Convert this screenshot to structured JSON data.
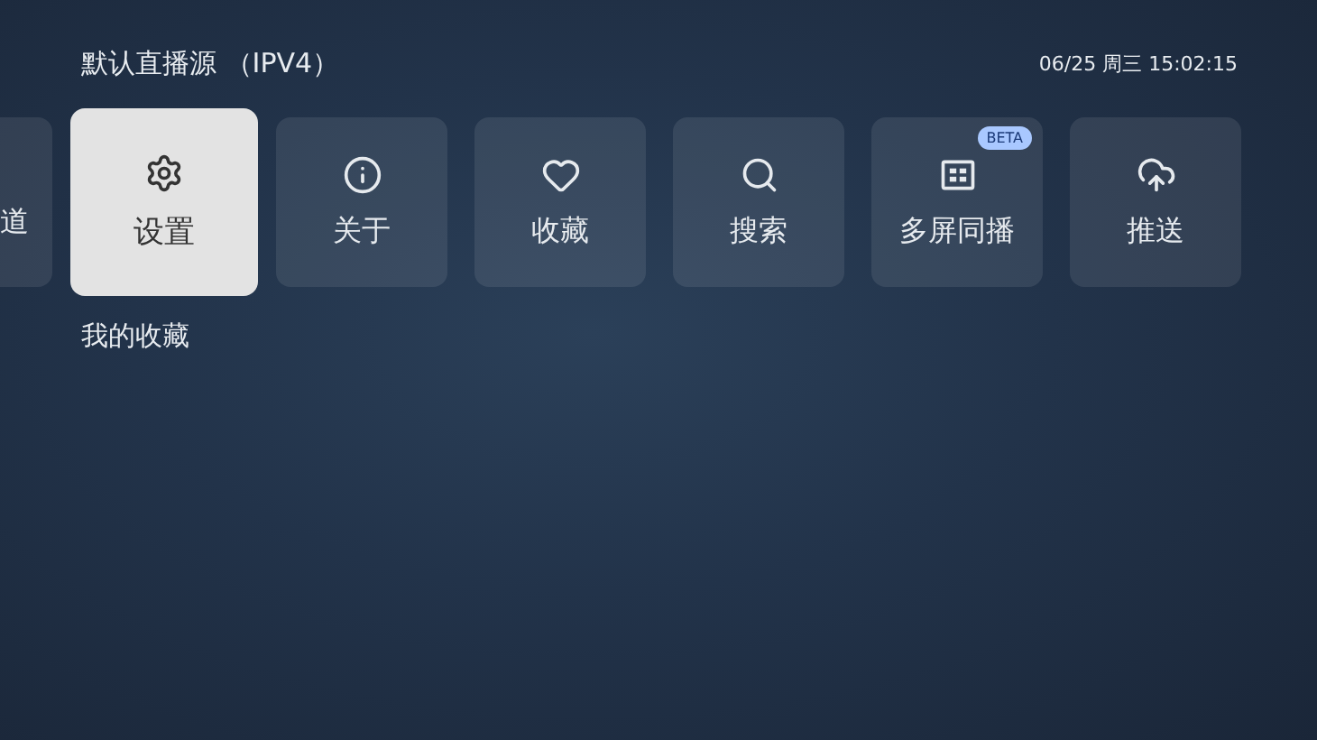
{
  "header": {
    "title": "默认直播源 （IPV4）",
    "clock": "06/25 周三 15:02:15"
  },
  "tiles": [
    {
      "kind": "partial",
      "label": "道",
      "selected": false
    },
    {
      "kind": "settings",
      "label": "设置",
      "selected": true
    },
    {
      "kind": "info",
      "label": "关于",
      "selected": false
    },
    {
      "kind": "heart",
      "label": "收藏",
      "selected": false
    },
    {
      "kind": "search",
      "label": "搜索",
      "selected": false
    },
    {
      "kind": "grid",
      "label": "多屏同播",
      "selected": false,
      "badge": "BETA"
    },
    {
      "kind": "upload",
      "label": "推送",
      "selected": false
    }
  ],
  "section_title": "我的收藏"
}
